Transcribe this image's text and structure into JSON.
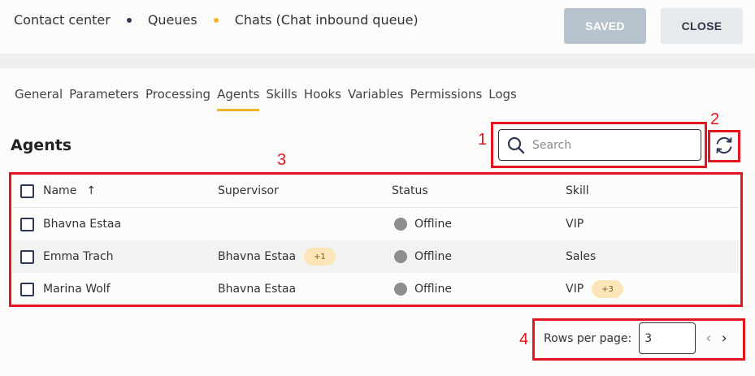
{
  "breadcrumb": {
    "items": [
      "Contact center",
      "Queues",
      "Chats (Chat inbound queue)"
    ],
    "separator_colors": [
      "#2d3a55",
      "#f0b429"
    ]
  },
  "header": {
    "saved_label": "SAVED",
    "close_label": "CLOSE"
  },
  "tabs": [
    "General",
    "Parameters",
    "Processing",
    "Agents",
    "Skills",
    "Hooks",
    "Variables",
    "Permissions",
    "Logs"
  ],
  "active_tab": "Agents",
  "section_title": "Agents",
  "search": {
    "placeholder": "Search",
    "value": ""
  },
  "annotations": [
    "1",
    "2",
    "3",
    "4"
  ],
  "table": {
    "columns": [
      "Name",
      "Supervisor",
      "Status",
      "Skill"
    ],
    "sort_indicator": "↑",
    "rows": [
      {
        "name": "Bhavna Estaa",
        "supervisor": "",
        "supervisor_extra": "",
        "status": "Offline",
        "skill": "VIP",
        "skill_extra": ""
      },
      {
        "name": "Emma Trach",
        "supervisor": "Bhavna Estaa",
        "supervisor_extra": "+1",
        "status": "Offline",
        "skill": "Sales",
        "skill_extra": ""
      },
      {
        "name": "Marina Wolf",
        "supervisor": "Bhavna Estaa",
        "supervisor_extra": "",
        "status": "Offline",
        "skill": "VIP",
        "skill_extra": "+3"
      }
    ]
  },
  "pagination": {
    "rows_per_page_label": "Rows per page:",
    "rows_per_page_value": "3",
    "prev_icon": "‹",
    "next_icon": "›"
  },
  "colors": {
    "accent": "#f0b429",
    "annotation": "#e3161f",
    "status_offline": "#8e8e8e"
  }
}
